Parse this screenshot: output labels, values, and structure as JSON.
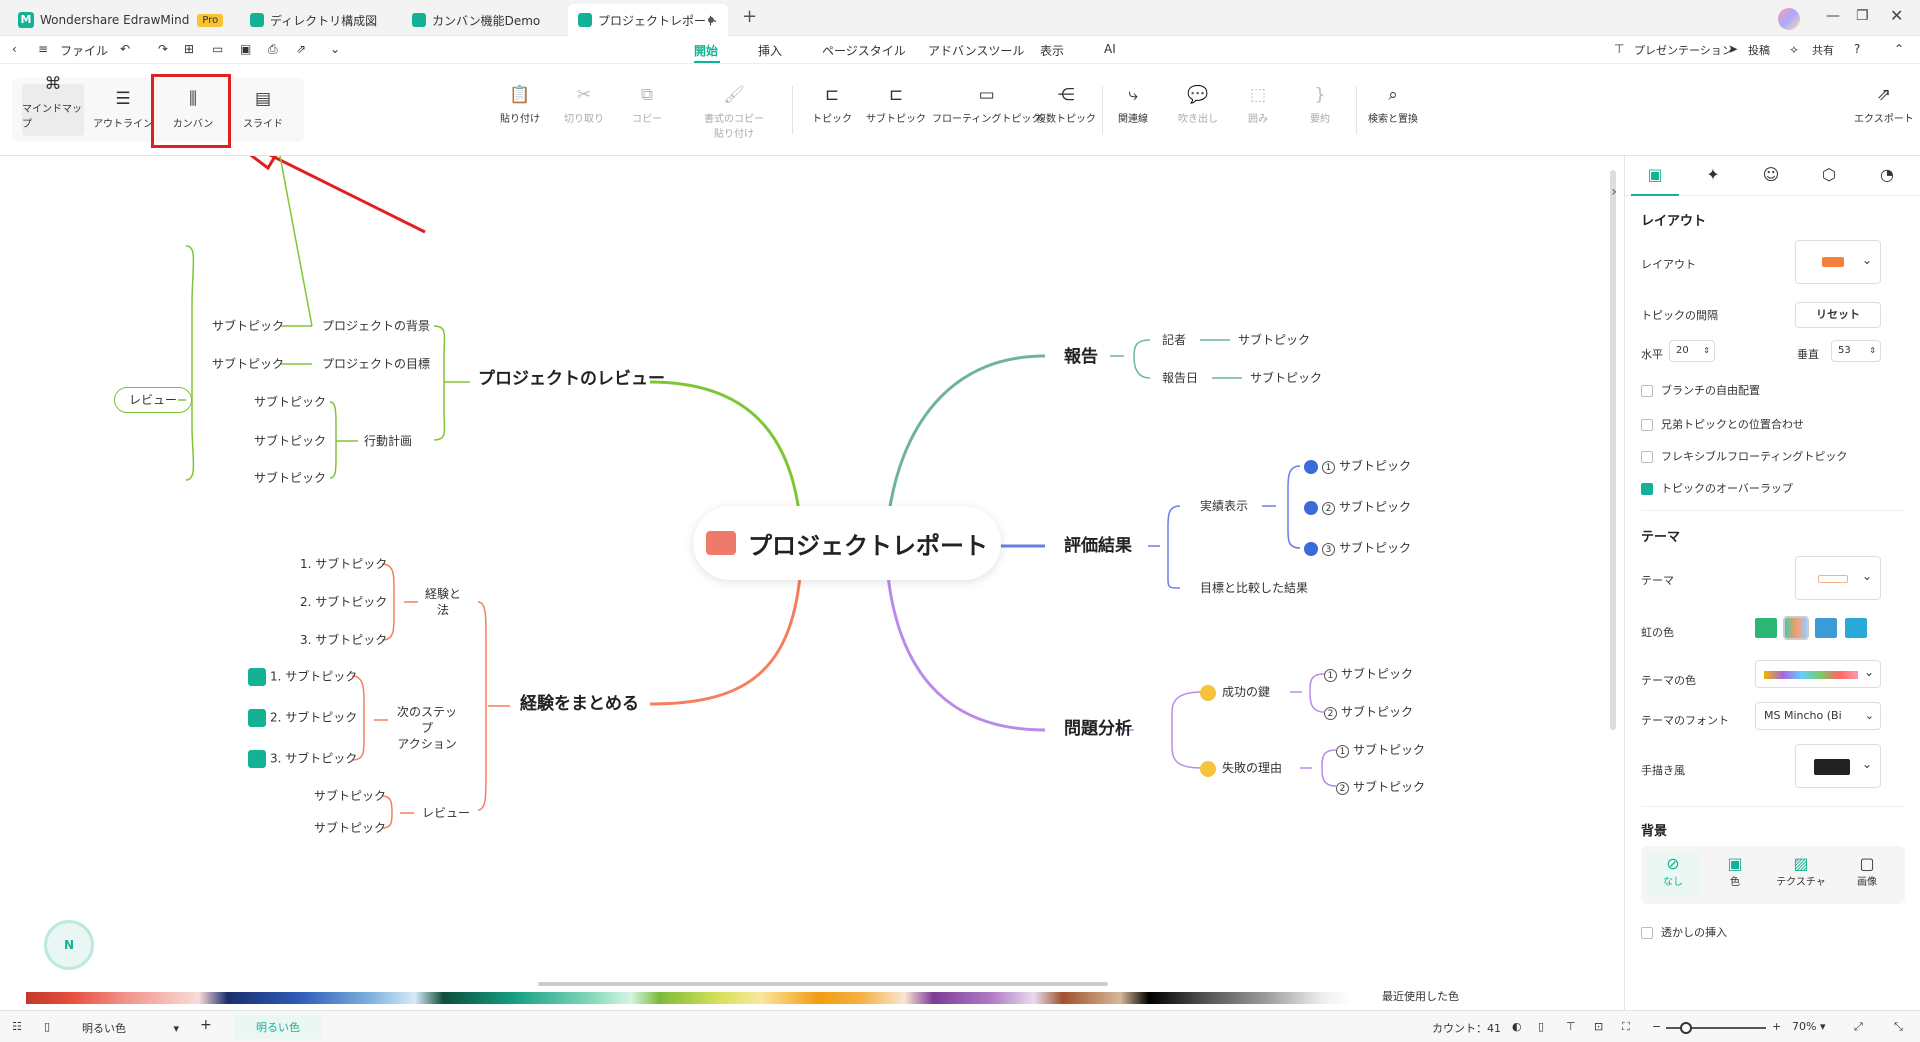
{
  "tabs": [
    {
      "label": "Wondershare EdrawMind",
      "badge": "Pro"
    },
    {
      "label": "ディレクトリ構成図"
    },
    {
      "label": "カンバン機能Demo"
    },
    {
      "label": "プロジェクトレポート"
    }
  ],
  "menubar": {
    "file": "ファイル",
    "menus": [
      "開始",
      "挿入",
      "ページスタイル",
      "アドバンスツール",
      "表示",
      "AI"
    ],
    "active": "開始",
    "right": [
      "プレゼンテーション",
      "投稿",
      "共有"
    ]
  },
  "views": [
    "マインドマップ",
    "アウトライン",
    "カンバン",
    "スライド"
  ],
  "toolbar": {
    "paste": "貼り付け",
    "cut": "切り取り",
    "copy": "コピー",
    "format_copy": "書式のコピー\n貼り付け",
    "topic": "トピック",
    "subtopic": "サブトピック",
    "floating": "フローティングトピック",
    "multiple": "複数トピック",
    "relation": "関連線",
    "callout": "吹き出し",
    "boundary": "囲み",
    "summary": "要約",
    "find": "検索と置換",
    "export": "エクスポート"
  },
  "mindmap": {
    "central": "プロジェクトレポート",
    "branches": {
      "review": {
        "title": "プロジェクトのレビュー",
        "label": "レビュー",
        "bg": "プロジェクトの背景",
        "goal": "プロジェクトの目標",
        "plan": "行動計画",
        "sub": "サブトピック"
      },
      "report": {
        "title": "報告",
        "writer": "記者",
        "date": "報告日",
        "sub": "サブトピック"
      },
      "eval": {
        "title": "評価結果",
        "actual": "実績表示",
        "compare": "目標と比較した結果",
        "items": [
          "サブトピック",
          "サブトピック",
          "サブトピック"
        ]
      },
      "summary": {
        "title": "経験をまとめる",
        "method": "経験と\n法",
        "next": "次のステップ\nアクション",
        "review": "レビュー",
        "n1": "1. サブトピック",
        "n2": "2. サブトピック",
        "n3": "3. サブトピック",
        "sub": "サブトピック"
      },
      "problem": {
        "title": "問題分析",
        "success": "成功の鍵",
        "failure": "失敗の理由",
        "sub": "サブトピック"
      }
    }
  },
  "panel": {
    "layout_header": "レイアウト",
    "layout_label": "レイアウト",
    "spacing_label": "トピックの間隔",
    "reset": "リセット",
    "h_label": "水平",
    "h_value": "20",
    "v_label": "垂直",
    "v_value": "53",
    "checks": [
      {
        "label": "ブランチの自由配置",
        "checked": false
      },
      {
        "label": "兄弟トピックとの位置合わせ",
        "checked": false
      },
      {
        "label": "フレキシブルフローティングトピック",
        "checked": false
      },
      {
        "label": "トピックのオーバーラップ",
        "checked": true
      }
    ],
    "theme_header": "テーマ",
    "theme_label": "テーマ",
    "rainbow_label": "虹の色",
    "theme_color_label": "テーマの色",
    "theme_font_label": "テーマのフォント",
    "font_value": "MS Mincho (Bi",
    "hand_label": "手描き風",
    "bg_header": "背景",
    "bg_opts": [
      "なし",
      "色",
      "テクスチャ",
      "画像"
    ],
    "watermark": "透かしの挿入"
  },
  "status": {
    "theme": "明るい色",
    "sheet": "明るい色",
    "count": "カウント：41",
    "zoom": "70%",
    "recent": "最近使用した色"
  },
  "colors": {
    "accent": "#13b295",
    "highlight": "#e02020",
    "review": "#7ec636",
    "summary": "#f47e5e",
    "report": "#6fb39b",
    "eval": "#6b7be8",
    "problem": "#b98be8"
  }
}
